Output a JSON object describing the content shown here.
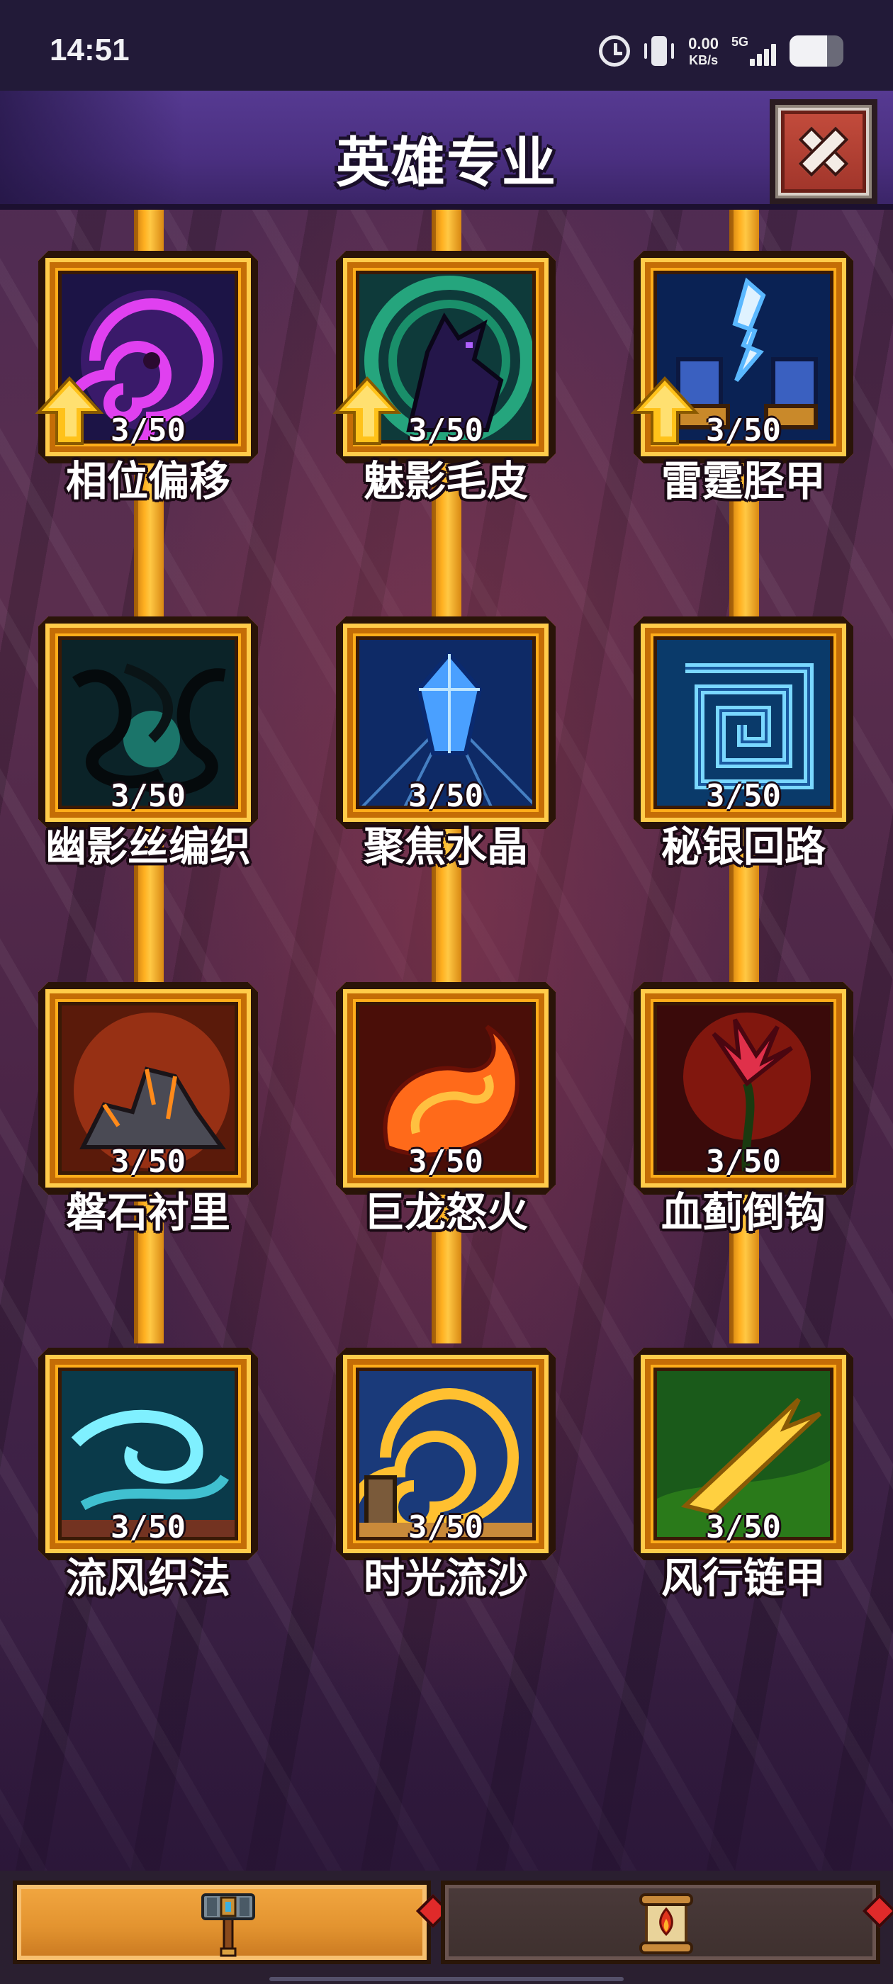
{
  "status_bar": {
    "time": "14:51",
    "net_speed_value": "0.00",
    "net_speed_unit": "KB/s",
    "network_type": "5G",
    "icons": [
      "alarm-icon",
      "vibrate-icon",
      "signal-icon",
      "battery-icon"
    ],
    "battery_level": 0.7
  },
  "header": {
    "title": "英雄专业",
    "close_icon": "close-icon"
  },
  "skills": [
    {
      "name": "相位偏移",
      "level": "3/50",
      "upgradable": true,
      "icon": "purple-vortex-icon"
    },
    {
      "name": "魅影毛皮",
      "level": "3/50",
      "upgradable": true,
      "icon": "shadow-wolf-icon"
    },
    {
      "name": "雷霆胫甲",
      "level": "3/50",
      "upgradable": true,
      "icon": "lightning-greaves-icon"
    },
    {
      "name": "幽影丝编织",
      "level": "3/50",
      "upgradable": false,
      "icon": "shadow-tendrils-icon"
    },
    {
      "name": "聚焦水晶",
      "level": "3/50",
      "upgradable": false,
      "icon": "blue-crystal-icon"
    },
    {
      "name": "秘银回路",
      "level": "3/50",
      "upgradable": false,
      "icon": "mithril-spiral-icon"
    },
    {
      "name": "磐石衬里",
      "level": "3/50",
      "upgradable": false,
      "icon": "rock-pile-icon"
    },
    {
      "name": "巨龙怒火",
      "level": "3/50",
      "upgradable": false,
      "icon": "dragon-fire-icon"
    },
    {
      "name": "血蓟倒钩",
      "level": "3/50",
      "upgradable": false,
      "icon": "blood-thistle-icon"
    },
    {
      "name": "流风织法",
      "level": "3/50",
      "upgradable": false,
      "icon": "wind-swirl-icon"
    },
    {
      "name": "时光流沙",
      "level": "3/50",
      "upgradable": false,
      "icon": "time-sand-icon"
    },
    {
      "name": "风行链甲",
      "level": "3/50",
      "upgradable": false,
      "icon": "wind-slash-icon"
    }
  ],
  "tabs": [
    {
      "icon": "hammer-icon",
      "selected": true
    },
    {
      "icon": "scroll-icon",
      "selected": false
    }
  ],
  "colors": {
    "frame_gold": "#ffad1a",
    "title_bar": "#4a2f80",
    "close_red": "#b33f31",
    "upgrade_arrow": "#ffc21a"
  }
}
